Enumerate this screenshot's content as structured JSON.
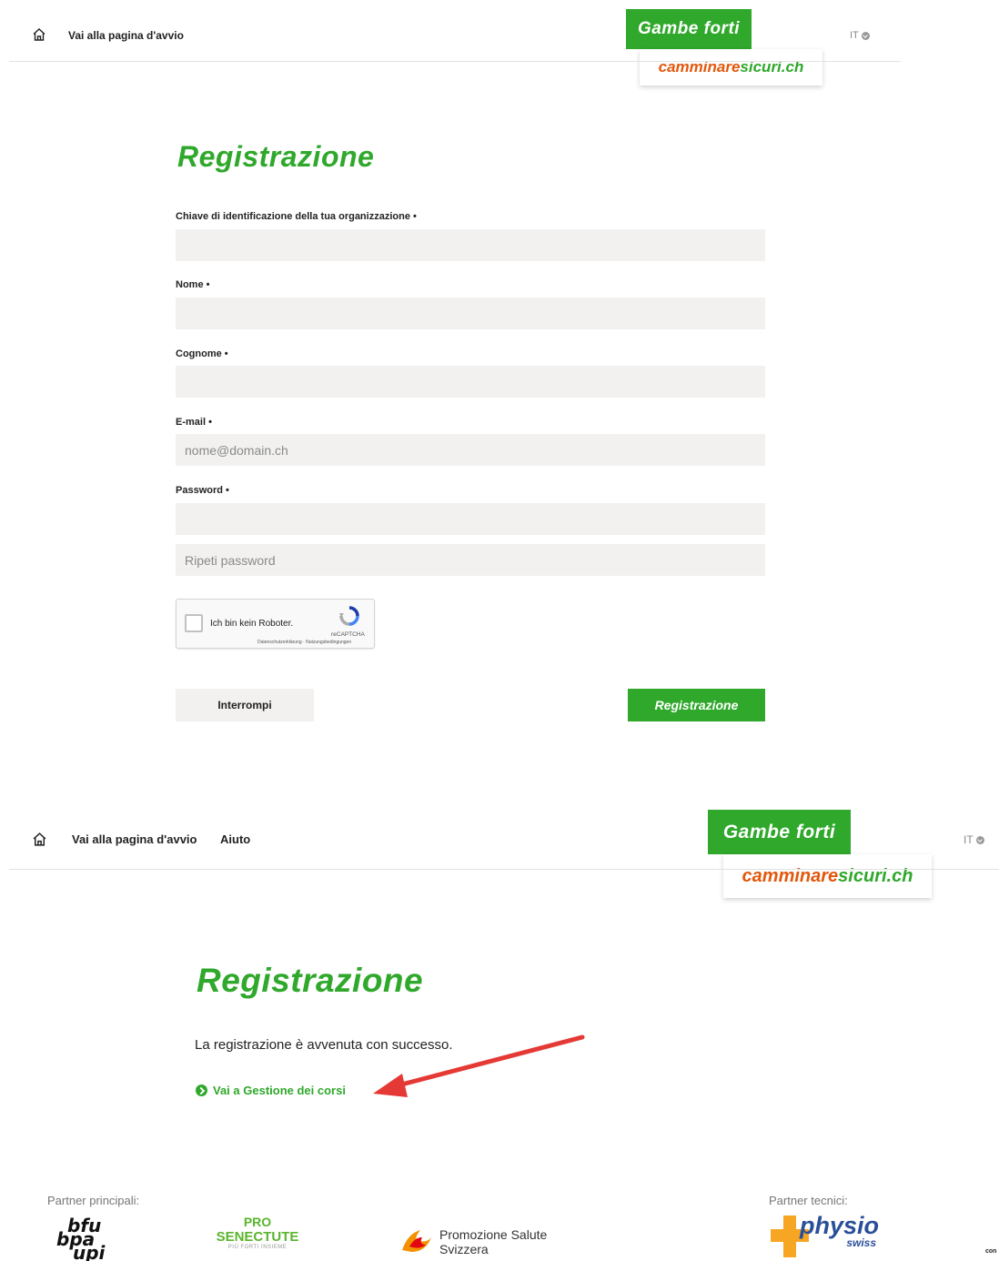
{
  "top": {
    "nav": {
      "home_label": "Vai alla pagina d'avvio"
    },
    "logo": {
      "line1": "Gambe forti",
      "line2_part1": "camminare",
      "line2_part2": "sicuri.ch"
    },
    "lang": "IT",
    "title": "Registrazione",
    "form": {
      "org_key_label": "Chiave di identificazione della tua organizzazione •",
      "name_label": "Nome •",
      "surname_label": "Cognome •",
      "email_label": "E-mail •",
      "email_placeholder": "nome@domain.ch",
      "password_label": "Password •",
      "repeat_password_placeholder": "Ripeti password"
    },
    "captcha": {
      "text": "Ich bin kein Roboter.",
      "brand": "reCAPTCHA",
      "terms": "Datenschutzerklärung · Nutzungsbedingungen"
    },
    "buttons": {
      "cancel": "Interrompi",
      "submit": "Registrazione"
    }
  },
  "bottom": {
    "nav": {
      "home_label": "Vai alla pagina d'avvio",
      "help_label": "Aiuto"
    },
    "logo": {
      "line1": "Gambe forti",
      "line2_part1": "camminare",
      "line2_part2": "sicuri.ch"
    },
    "lang": "IT",
    "title": "Registrazione",
    "success_message": "La registrazione è avvenuta con successo.",
    "course_link": "Vai a Gestione dei corsi",
    "partners": {
      "main_label": "Partner principali:",
      "tech_label": "Partner tecnici:",
      "bfu": [
        "bfu",
        "bpa",
        "upi"
      ],
      "pro_senectute": [
        "PRO",
        "SENECTUTE",
        "PIÙ FORTI INSIEME"
      ],
      "promotion": [
        "Promozione Salute",
        "Svizzera"
      ],
      "physio": [
        "physio",
        "swiss"
      ]
    },
    "edge_text": "con"
  },
  "colors": {
    "brand_green": "#2fa82b",
    "brand_orange": "#e2580d",
    "arrow_red": "#e53935"
  }
}
